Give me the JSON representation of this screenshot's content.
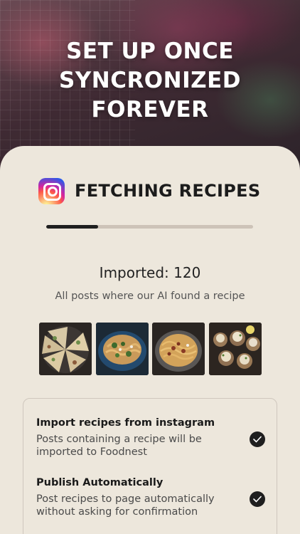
{
  "hero": {
    "title_lines": [
      "SET UP ONCE",
      "SYNCRONIZED",
      "FOREVER"
    ]
  },
  "fetch": {
    "icon": "instagram-icon",
    "title": "FETCHING RECIPES",
    "progress": 0.25
  },
  "stats": {
    "imported_text": "Imported: 120",
    "subtitle": "All posts where our AI found a recipe"
  },
  "thumbnails": [
    {
      "name": "pizza-slices-thumbnail"
    },
    {
      "name": "pasta-with-greens-thumbnail"
    },
    {
      "name": "spaghetti-bolognese-thumbnail"
    },
    {
      "name": "stuffed-mushrooms-thumbnail"
    }
  ],
  "options": [
    {
      "title": "Import recipes from instagram",
      "description": "Posts containing a recipe will be imported to Foodnest",
      "checked": true,
      "icon": "check-icon"
    },
    {
      "title": "Publish Automatically",
      "description": "Post recipes to page automatically without asking for confirmation",
      "checked": true,
      "icon": "check-icon"
    }
  ],
  "colors": {
    "sheet_background": "#ede7dc",
    "progress_fill": "#1f1f1f",
    "progress_track": "#cdc3b8",
    "check_background": "#1f1f1f"
  }
}
